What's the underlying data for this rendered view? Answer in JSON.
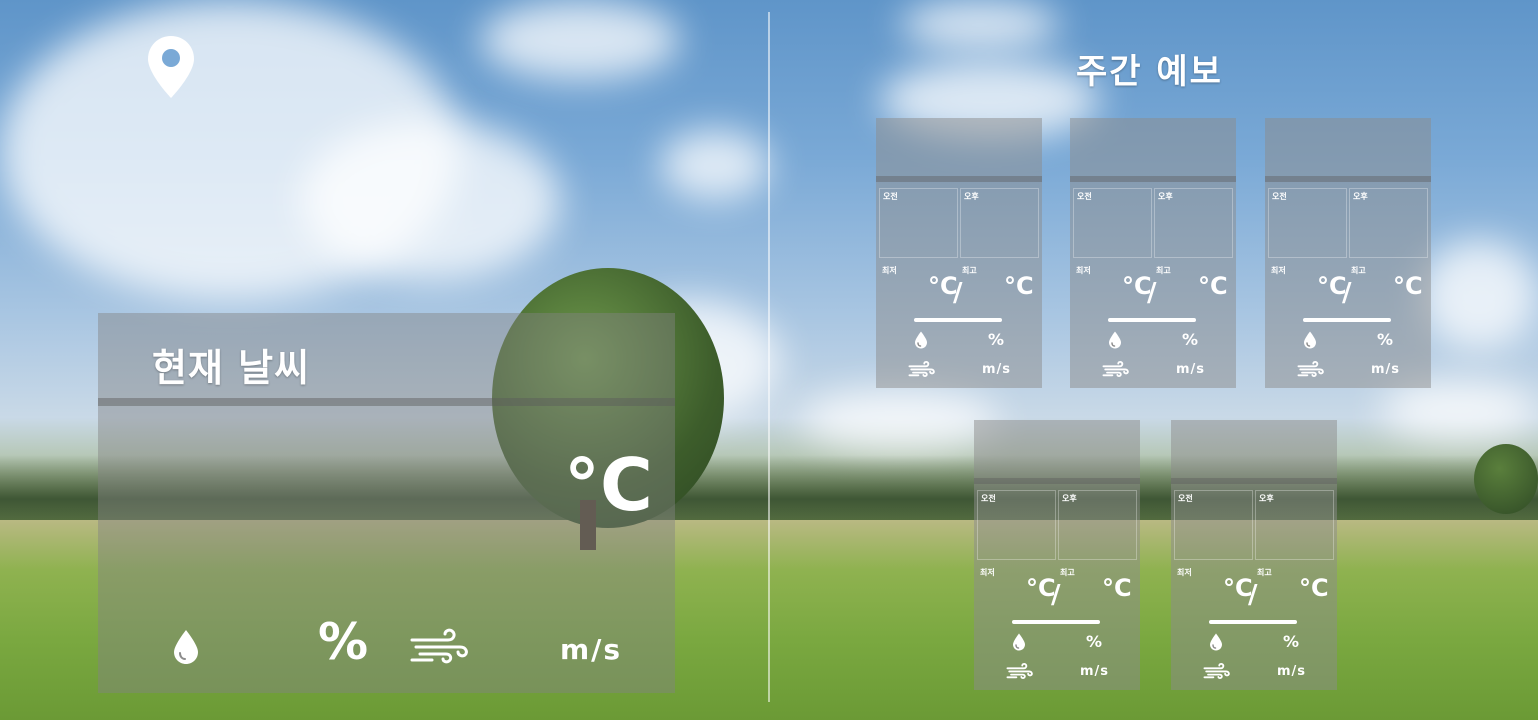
{
  "current": {
    "title": "현재 날씨",
    "temp_unit": "°C",
    "humidity_unit": "%",
    "wind_unit": "m/s"
  },
  "weekly": {
    "title": "주간 예보",
    "cards": [
      {
        "am": "오전",
        "pm": "오후",
        "min": "최저",
        "max": "최고",
        "min_unit": "°C",
        "slash": "/",
        "max_unit": "°C",
        "humidity_unit": "%",
        "wind_unit": "m/s"
      },
      {
        "am": "오전",
        "pm": "오후",
        "min": "최저",
        "max": "최고",
        "min_unit": "°C",
        "slash": "/",
        "max_unit": "°C",
        "humidity_unit": "%",
        "wind_unit": "m/s"
      },
      {
        "am": "오전",
        "pm": "오후",
        "min": "최저",
        "max": "최고",
        "min_unit": "°C",
        "slash": "/",
        "max_unit": "°C",
        "humidity_unit": "%",
        "wind_unit": "m/s"
      },
      {
        "am": "오전",
        "pm": "오후",
        "min": "최저",
        "max": "최고",
        "min_unit": "°C",
        "slash": "/",
        "max_unit": "°C",
        "humidity_unit": "%",
        "wind_unit": "m/s"
      },
      {
        "am": "오전",
        "pm": "오후",
        "min": "최저",
        "max": "최고",
        "min_unit": "°C",
        "slash": "/",
        "max_unit": "°C",
        "humidity_unit": "%",
        "wind_unit": "m/s"
      }
    ]
  },
  "icons": {
    "location": "map-pin-icon",
    "humidity": "water-drop-icon",
    "wind": "wind-icon"
  }
}
